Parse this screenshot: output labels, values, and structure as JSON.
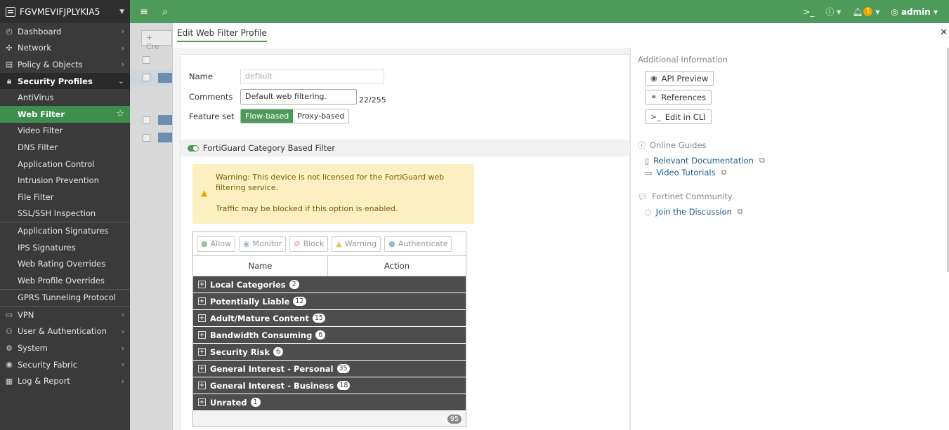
{
  "device_name": "FGVMEVIFJPLYKIA5",
  "sidebar": {
    "top_items": [
      {
        "label": "Dashboard",
        "icon": "dashboard-icon"
      },
      {
        "label": "Network",
        "icon": "network-icon"
      },
      {
        "label": "Policy & Objects",
        "icon": "policy-icon"
      }
    ],
    "security_profiles": {
      "label": "Security Profiles",
      "children_a": [
        "AntiVirus",
        "Web Filter",
        "Video Filter",
        "DNS Filter",
        "Application Control",
        "Intrusion Prevention",
        "File Filter",
        "SSL/SSH Inspection"
      ],
      "children_b": [
        "Application Signatures",
        "IPS Signatures",
        "Web Rating Overrides",
        "Web Profile Overrides"
      ],
      "children_c": [
        "GPRS Tunneling Protocol"
      ],
      "active": "Web Filter"
    },
    "bottom_items": [
      {
        "label": "VPN",
        "icon": "vpn-icon"
      },
      {
        "label": "User & Authentication",
        "icon": "user-icon"
      },
      {
        "label": "System",
        "icon": "gear-icon"
      },
      {
        "label": "Security Fabric",
        "icon": "fabric-icon"
      },
      {
        "label": "Log & Report",
        "icon": "log-icon"
      }
    ]
  },
  "topbar": {
    "user": "admin",
    "notification_count": "1"
  },
  "bg_list": {
    "create_label": "+ Cre"
  },
  "modal": {
    "title": "Edit Web Filter Profile",
    "form": {
      "name_label": "Name",
      "name_value": "default",
      "comments_label": "Comments",
      "comments_value": "Default web filtering.",
      "comments_count": "22/255",
      "feature_label": "Feature set",
      "feature_options": [
        "Flow-based",
        "Proxy-based"
      ],
      "feature_selected": "Flow-based"
    },
    "fortiguard": {
      "label": "FortiGuard Category Based Filter",
      "enabled": true
    },
    "warning": {
      "line1": "Warning: This device is not licensed for the FortiGuard web filtering service.",
      "line2": "Traffic may be blocked if this option is enabled."
    },
    "actions": [
      "Allow",
      "Monitor",
      "Block",
      "Warning",
      "Authenticate"
    ],
    "table": {
      "columns": [
        "Name",
        "Action"
      ],
      "categories": [
        {
          "name": "Local Categories",
          "count": "2"
        },
        {
          "name": "Potentially Liable",
          "count": "12"
        },
        {
          "name": "Adult/Mature Content",
          "count": "15"
        },
        {
          "name": "Bandwidth Consuming",
          "count": "6"
        },
        {
          "name": "Security Risk",
          "count": "6"
        },
        {
          "name": "General Interest - Personal",
          "count": "35"
        },
        {
          "name": "General Interest - Business",
          "count": "18"
        },
        {
          "name": "Unrated",
          "count": "1"
        }
      ],
      "total": "95"
    },
    "info": {
      "additional_title": "Additional Information",
      "buttons": [
        "API Preview",
        "References",
        "Edit in CLI"
      ],
      "guides_title": "Online Guides",
      "guides": [
        "Relevant Documentation",
        "Video Tutorials"
      ],
      "community_title": "Fortinet Community",
      "community_link": "Join the Discussion"
    }
  },
  "colors": {
    "brand_green": "#4d9a5b",
    "sidebar_bg": "#3a3a3a",
    "warning_bg": "#fcefc2"
  }
}
